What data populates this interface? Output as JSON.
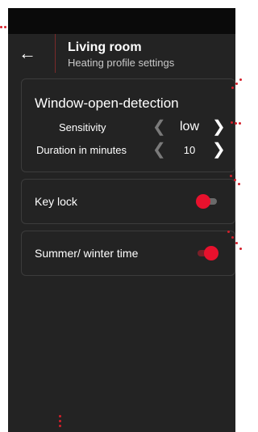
{
  "header": {
    "back_icon": "arrow-left-icon",
    "title": "Living room",
    "subtitle": "Heating profile settings"
  },
  "window_open_detection": {
    "title": "Window-open-detection",
    "sensitivity": {
      "label": "Sensitivity",
      "value": "low",
      "left_icon": "chevron-left-icon",
      "right_icon": "chevron-right-icon"
    },
    "duration": {
      "label": "Duration in minutes",
      "value": "10",
      "left_icon": "chevron-left-icon",
      "right_icon": "chevron-right-icon"
    }
  },
  "key_lock": {
    "label": "Key lock",
    "enabled": false
  },
  "summer_winter_time": {
    "label": "Summer/ winter time",
    "enabled": true
  },
  "colors": {
    "background": "#232323",
    "status_bar": "#0a0a0a",
    "accent": "#e8112d",
    "card_border": "#3c3c3c"
  }
}
